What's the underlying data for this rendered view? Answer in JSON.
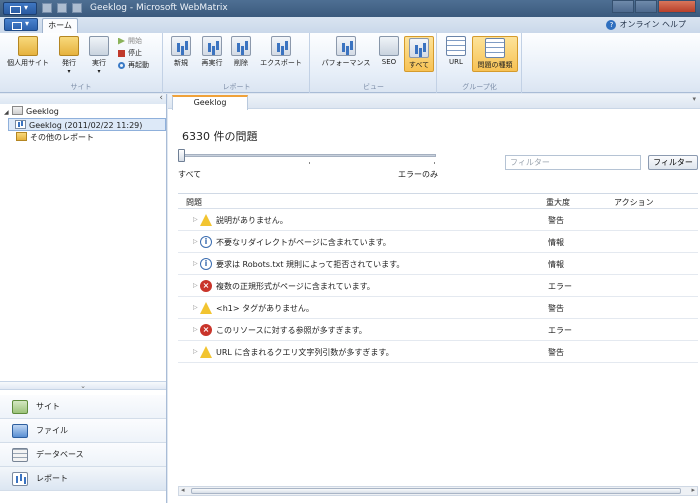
{
  "window": {
    "title": "Geeklog - Microsoft WebMatrix"
  },
  "ribbon": {
    "tab_home": "ホーム",
    "help": "オンライン ヘルプ",
    "groups": {
      "site": {
        "title": "サイト",
        "my_sites": "個人用サイト",
        "publish": "発行",
        "run": "実行",
        "start": "開始",
        "stop": "停止",
        "restart": "再起動"
      },
      "reports": {
        "title": "レポート",
        "new": "新規",
        "rerun": "再実行",
        "delete": "削除",
        "export": "エクスポート"
      },
      "view": {
        "title": "ビュー",
        "performance": "パフォーマンス",
        "seo": "SEO",
        "all": "すべて"
      },
      "group_by": {
        "title": "グループ化",
        "url": "URL",
        "issue_type": "問題の種類"
      }
    }
  },
  "tree": {
    "root": "Geeklog",
    "report": "Geeklog (2011/02/22 11:29)",
    "other": "その他のレポート"
  },
  "workspaces": [
    "サイト",
    "ファイル",
    "データベース",
    "レポート"
  ],
  "doc": {
    "tab": "Geeklog",
    "count": "6330 件の問題",
    "slider_left": "すべて",
    "slider_right": "エラーのみ",
    "filter_placeholder": "フィルター",
    "filter_button": "フィルター",
    "columns": {
      "issue": "問題",
      "severity": "重大度",
      "action": "アクション"
    },
    "rows": [
      {
        "icon": "warning",
        "message": "説明がありません。",
        "severity": "警告"
      },
      {
        "icon": "info",
        "message": "不要なリダイレクトがページに含まれています。",
        "severity": "情報"
      },
      {
        "icon": "info",
        "message": "要求は Robots.txt 規則によって拒否されています。",
        "severity": "情報"
      },
      {
        "icon": "error",
        "message": "複数の正規形式がページに含まれています。",
        "severity": "エラー"
      },
      {
        "icon": "warning",
        "message": "<h1> タグがありません。",
        "severity": "警告"
      },
      {
        "icon": "error",
        "message": "このリソースに対する参照が多すぎます。",
        "severity": "エラー"
      },
      {
        "icon": "warning",
        "message": "URL に含まれるクエリ文字列引数が多すぎます。",
        "severity": "警告"
      }
    ]
  }
}
